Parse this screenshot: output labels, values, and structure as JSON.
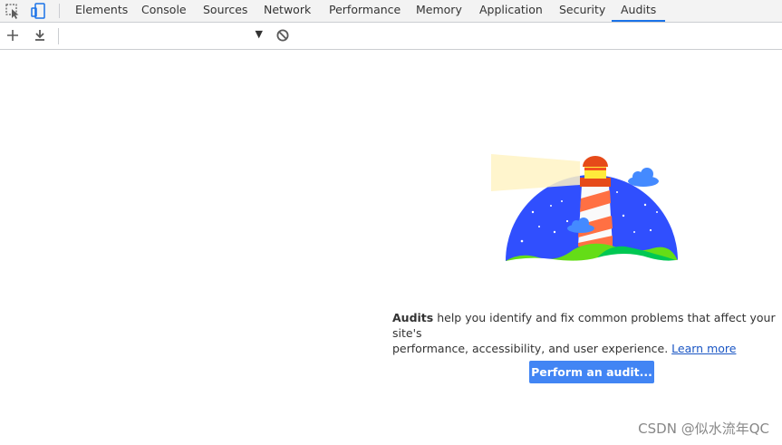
{
  "devtools": {
    "tabs": [
      {
        "label": "Elements"
      },
      {
        "label": "Console"
      },
      {
        "label": "Sources"
      },
      {
        "label": "Network"
      },
      {
        "label": "Performance"
      },
      {
        "label": "Memory"
      },
      {
        "label": "Application"
      },
      {
        "label": "Security"
      },
      {
        "label": "Audits"
      }
    ],
    "active_tab": "Audits",
    "accent_color": "#1a73e8"
  },
  "toolbar": {
    "icons": [
      "plus-icon",
      "download-icon",
      "dropdown-arrow-icon",
      "block-icon"
    ],
    "report_select_value": ""
  },
  "audits": {
    "description_bold": "Audits",
    "description_line1": " help you identify and fix common problems that affect your site's",
    "description_line2": "performance, accessibility, and user experience. ",
    "learn_more_label": "Learn more",
    "perform_button_label": "Perform an audit..."
  },
  "watermark": "CSDN @似水流年QC"
}
